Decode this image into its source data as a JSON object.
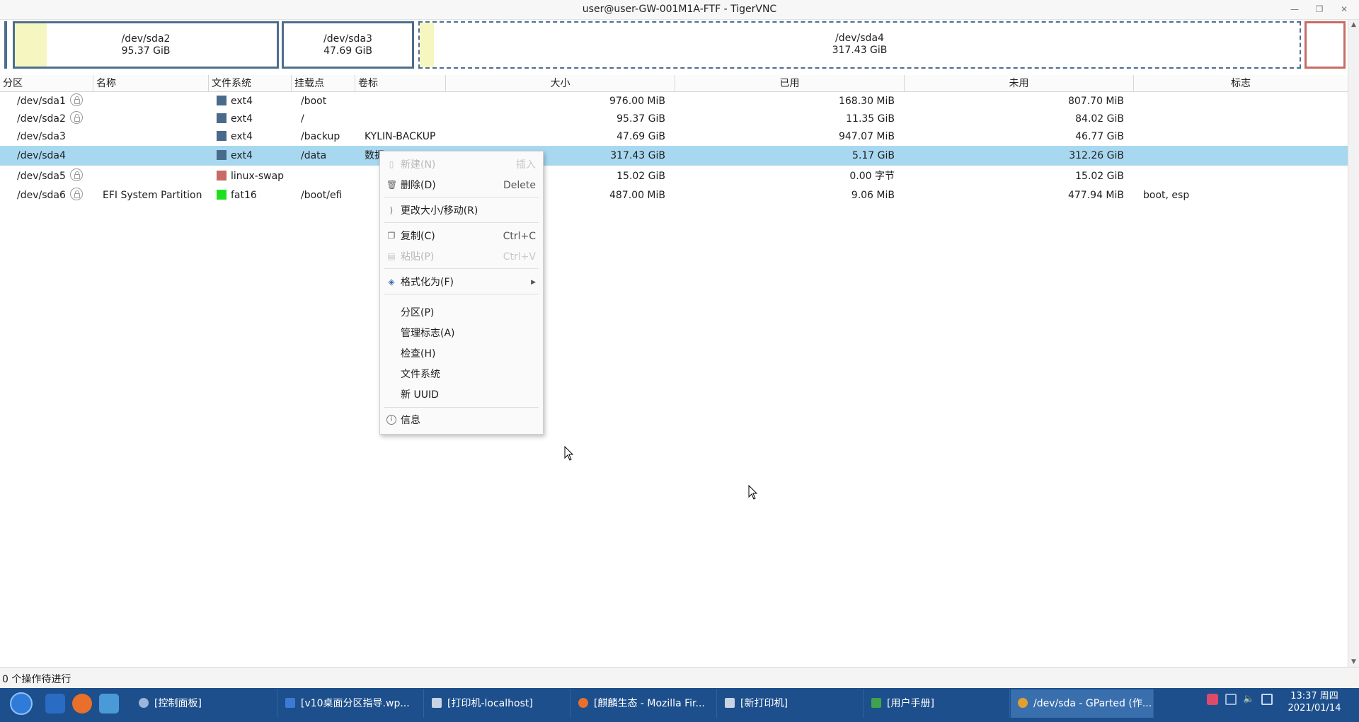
{
  "window": {
    "title": "user@user-GW-001M1A-FTF - TigerVNC"
  },
  "partition_map": [
    {
      "name": "/dev/sda2",
      "size": "95.37 GiB"
    },
    {
      "name": "/dev/sda3",
      "size": "47.69 GiB"
    },
    {
      "name": "/dev/sda4",
      "size": "317.43 GiB"
    }
  ],
  "table": {
    "headers": [
      "分区",
      "名称",
      "文件系统",
      "挂载点",
      "卷标",
      "大小",
      "已用",
      "未用",
      "标志"
    ],
    "rows": [
      {
        "partition": "/dev/sda1",
        "locked": true,
        "name": "",
        "fs": "ext4",
        "fs_color": "#4a6a8c",
        "mount": "/boot",
        "label": "",
        "size": "976.00 MiB",
        "used": "168.30 MiB",
        "unused": "807.70 MiB",
        "flags": ""
      },
      {
        "partition": "/dev/sda2",
        "locked": true,
        "name": "",
        "fs": "ext4",
        "fs_color": "#4a6a8c",
        "mount": "/",
        "label": "",
        "size": "95.37 GiB",
        "used": "11.35 GiB",
        "unused": "84.02 GiB",
        "flags": ""
      },
      {
        "partition": "/dev/sda3",
        "locked": false,
        "name": "",
        "fs": "ext4",
        "fs_color": "#4a6a8c",
        "mount": "/backup",
        "label": "KYLIN-BACKUP",
        "size": "47.69 GiB",
        "used": "947.07 MiB",
        "unused": "46.77 GiB",
        "flags": ""
      },
      {
        "partition": "/dev/sda4",
        "locked": false,
        "name": "",
        "fs": "ext4",
        "fs_color": "#4a6a8c",
        "mount": "/data",
        "label": "数据",
        "size": "317.43 GiB",
        "used": "5.17 GiB",
        "unused": "312.26 GiB",
        "flags": "",
        "selected": true
      },
      {
        "partition": "/dev/sda5",
        "locked": true,
        "name": "",
        "fs": "linux-swap",
        "fs_color": "#c76b64",
        "mount": "",
        "label": "",
        "size": "15.02 GiB",
        "used": "0.00 字节",
        "unused": "15.02 GiB",
        "flags": ""
      },
      {
        "partition": "/dev/sda6",
        "locked": true,
        "name": "EFI System Partition",
        "fs": "fat16",
        "fs_color": "#1ee01e",
        "mount": "/boot/efi",
        "label": "",
        "size": "487.00 MiB",
        "used": "9.06 MiB",
        "unused": "477.94 MiB",
        "flags": "boot, esp"
      }
    ]
  },
  "context_menu": {
    "new": {
      "label": "新建(N)",
      "shortcut": "插入"
    },
    "delete": {
      "label": "删除(D)",
      "shortcut": "Delete"
    },
    "resize": {
      "label": "更改大小/移动(R)"
    },
    "copy": {
      "label": "复制(C)",
      "shortcut": "Ctrl+C"
    },
    "paste": {
      "label": "粘贴(P)",
      "shortcut": "Ctrl+V"
    },
    "format": {
      "label": "格式化为(F)"
    },
    "partition": {
      "label": "分区(P)"
    },
    "manage_flags": {
      "label": "管理标志(A)"
    },
    "check": {
      "label": "检查(H)"
    },
    "filesystem": {
      "label": "文件系统"
    },
    "new_uuid": {
      "label": "新 UUID"
    },
    "info": {
      "label": "信息"
    }
  },
  "statusbar": {
    "text": "0 个操作待进行"
  },
  "taskbar": {
    "tasks": [
      {
        "label": "[控制面板]",
        "icon_color": "#9ab6d8"
      },
      {
        "label": "[v10桌面分区指导.wp...",
        "icon_color": "#3d7ad6"
      },
      {
        "label": "[打印机-localhost]",
        "icon_color": "#c8d4e4"
      },
      {
        "label": "[麒麟生态 - Mozilla Fir...",
        "icon_color": "#e8702a"
      },
      {
        "label": "[新打印机]",
        "icon_color": "#c8d4e4"
      },
      {
        "label": "[用户手册]",
        "icon_color": "#3fa34d"
      },
      {
        "label": "/dev/sda - GParted (作...",
        "icon_color": "#e0a030",
        "active": true
      }
    ],
    "clock": {
      "time": "13:37 周四",
      "date": "2021/01/14"
    }
  }
}
